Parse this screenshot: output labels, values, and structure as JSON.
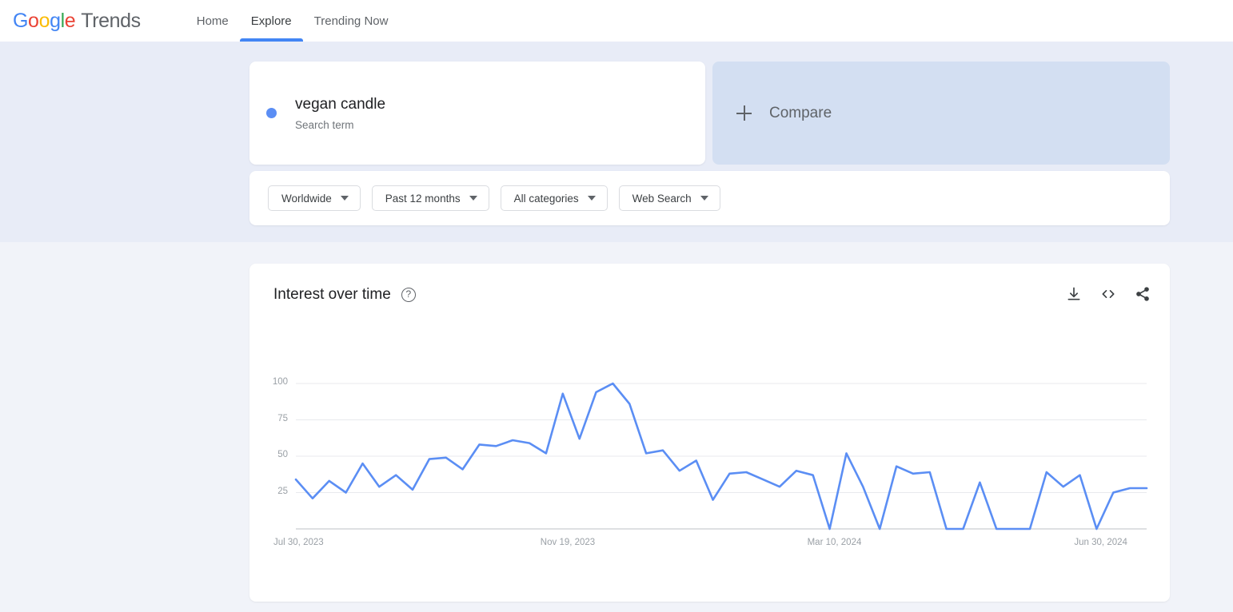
{
  "brand": {
    "letters": [
      "G",
      "o",
      "o",
      "g",
      "l",
      "e"
    ],
    "word": "Trends"
  },
  "nav": {
    "items": [
      {
        "label": "Home",
        "active": false
      },
      {
        "label": "Explore",
        "active": true
      },
      {
        "label": "Trending Now",
        "active": false
      }
    ]
  },
  "query": {
    "term": "vegan candle",
    "term_type": "Search term",
    "term_color": "#5b8ef4",
    "compare_label": "Compare"
  },
  "filters": [
    {
      "label": "Worldwide"
    },
    {
      "label": "Past 12 months"
    },
    {
      "label": "All categories"
    },
    {
      "label": "Web Search"
    }
  ],
  "chart_card": {
    "title": "Interest over time",
    "help_glyph": "?",
    "actions": [
      {
        "name": "download-icon",
        "title": "Download"
      },
      {
        "name": "embed-code-icon",
        "title": "Embed"
      },
      {
        "name": "share-icon",
        "title": "Share"
      }
    ]
  },
  "chart_data": {
    "type": "line",
    "title": "Interest over time",
    "xlabel": "",
    "ylabel": "",
    "ylim": [
      0,
      100
    ],
    "yticks": [
      25,
      50,
      75,
      100
    ],
    "grid": true,
    "legend": false,
    "line_color": "#5b8ef4",
    "series_name": "vegan candle",
    "x_tick_labels": [
      "Jul 30, 2023",
      "Nov 19, 2023",
      "Mar 10, 2024",
      "Jun 30, 2024"
    ],
    "x_tick_indices": [
      0,
      16,
      32,
      48
    ],
    "x": [
      "Jul 30, 2023",
      "Aug 6, 2023",
      "Aug 13, 2023",
      "Aug 20, 2023",
      "Aug 27, 2023",
      "Sep 3, 2023",
      "Sep 10, 2023",
      "Sep 17, 2023",
      "Sep 24, 2023",
      "Oct 1, 2023",
      "Oct 8, 2023",
      "Oct 15, 2023",
      "Oct 22, 2023",
      "Oct 29, 2023",
      "Nov 5, 2023",
      "Nov 12, 2023",
      "Nov 19, 2023",
      "Nov 26, 2023",
      "Dec 3, 2023",
      "Dec 10, 2023",
      "Dec 17, 2023",
      "Dec 24, 2023",
      "Dec 31, 2023",
      "Jan 7, 2024",
      "Jan 14, 2024",
      "Jan 21, 2024",
      "Jan 28, 2024",
      "Feb 4, 2024",
      "Feb 11, 2024",
      "Feb 18, 2024",
      "Feb 25, 2024",
      "Mar 3, 2024",
      "Mar 10, 2024",
      "Mar 17, 2024",
      "Mar 24, 2024",
      "Mar 31, 2024",
      "Apr 7, 2024",
      "Apr 14, 2024",
      "Apr 21, 2024",
      "Apr 28, 2024",
      "May 5, 2024",
      "May 12, 2024",
      "May 19, 2024",
      "May 26, 2024",
      "Jun 2, 2024",
      "Jun 9, 2024",
      "Jun 16, 2024",
      "Jun 23, 2024",
      "Jun 30, 2024",
      "Jul 7, 2024",
      "Jul 14, 2024",
      "Jul 21, 2024"
    ],
    "values": [
      34,
      21,
      33,
      25,
      45,
      29,
      37,
      27,
      48,
      49,
      41,
      58,
      57,
      61,
      59,
      52,
      93,
      62,
      94,
      100,
      86,
      52,
      54,
      40,
      47,
      20,
      38,
      39,
      34,
      29,
      40,
      37,
      0,
      52,
      29,
      0,
      43,
      38,
      39,
      0,
      0,
      32,
      0,
      0,
      0,
      39,
      29,
      37,
      0,
      25,
      28,
      28
    ]
  }
}
